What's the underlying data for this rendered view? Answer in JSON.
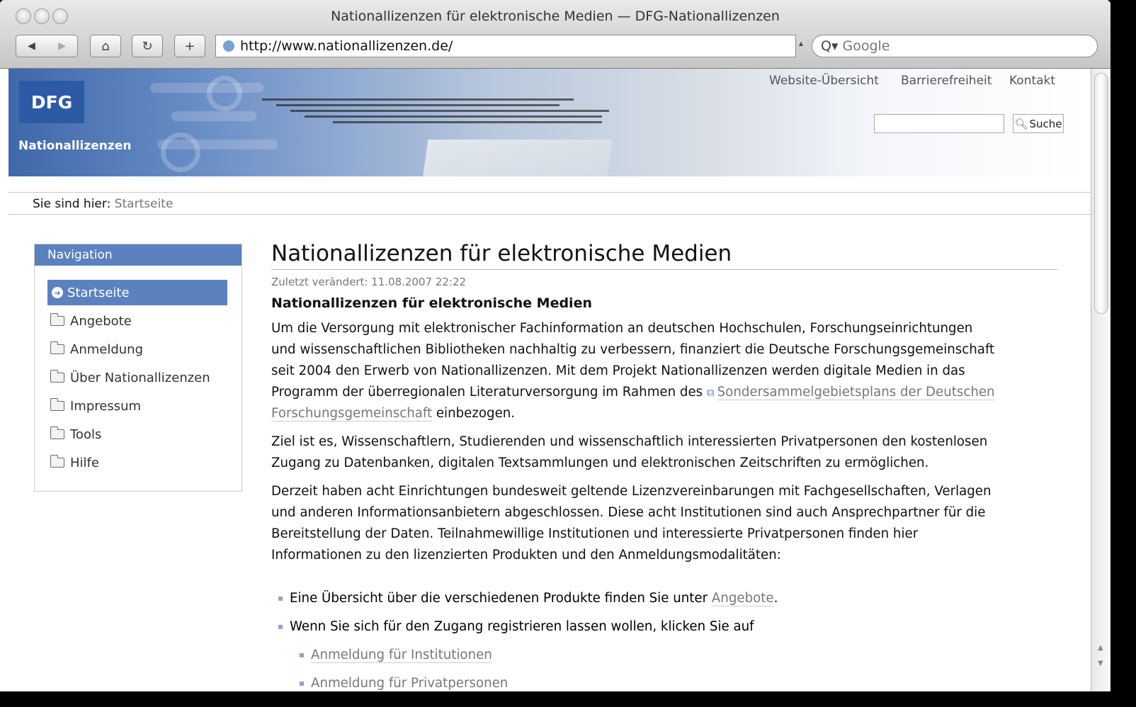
{
  "window": {
    "title": "Nationallizenzen für elektronische Medien — DFG-Nationallizenzen"
  },
  "browser": {
    "url": "http://www.nationallizenzen.de/",
    "search_placeholder": "Google",
    "back_icon": "back-arrow-icon",
    "forward_icon": "forward-arrow-icon",
    "home_icon": "home-icon",
    "reload_icon": "reload-icon",
    "add_icon": "plus-icon"
  },
  "header": {
    "logo": "DFG",
    "brand": "Nationallizenzen",
    "links": [
      "Website-Übersicht",
      "Barrierefreiheit",
      "Kontakt"
    ],
    "search_button": "Suche"
  },
  "breadcrumb": {
    "label": "Sie sind hier:",
    "current": "Startseite"
  },
  "navigation": {
    "title": "Navigation",
    "items": [
      "Startseite",
      "Angebote",
      "Anmeldung",
      "Über Nationallizenzen",
      "Impressum",
      "Tools",
      "Hilfe"
    ]
  },
  "content": {
    "title": "Nationallizenzen für elektronische Medien",
    "modified": "Zuletzt verändert: 11.08.2007 22:22",
    "subtitle": "Nationallizenzen für elektronische Medien",
    "p1_lines": [
      "Um die Versorgung mit elektronischer Fachinformation an deutschen Hochschulen, Forschungseinrichtungen",
      "und wissenschaftlichen Bibliotheken nachhaltig zu verbessern, finanziert die Deutsche Forschungsgemeinschaft",
      "seit 2004 den Erwerb von Nationallizenzen. Mit dem Projekt Nationallizenzen werden digitale Medien in das",
      "Programm der überregionalen Literaturversorgung im Rahmen des "
    ],
    "p1_link_a": "Sondersammelgebietsplans der Deutschen",
    "p1_link_b": "Forschungsgemeinschaft",
    "p1_end": " einbezogen.",
    "p2_lines": [
      "Ziel ist es, Wissenschaftlern, Studierenden und wissenschaftlich interessierten Privatpersonen den kostenlosen",
      "Zugang zu Datenbanken, digitalen Textsammlungen und elektronischen Zeitschriften zu ermöglichen."
    ],
    "p3_lines": [
      "Derzeit haben acht Einrichtungen bundesweit geltende Lizenzvereinbarungen mit Fachgesellschaften, Verlagen",
      "und anderen Informationsanbietern abgeschlossen. Diese acht Institutionen sind auch Ansprechpartner für die",
      "Bereitstellung der Daten. Teilnahmewillige Institutionen und interessierte Privatpersonen finden hier",
      "Informationen zu den lizenzierten Produkten und den Anmeldungsmodalitäten:"
    ],
    "list": {
      "item1_text": "Eine Übersicht über die verschiedenen Produkte finden Sie unter ",
      "item1_link": "Angebote",
      "item1_end": ".",
      "item2_text": "Wenn Sie sich für den Zugang registrieren lassen wollen, klicken Sie auf",
      "sub1": "Anmeldung für Institutionen",
      "sub2": "Anmeldung für Privatpersonen"
    }
  }
}
